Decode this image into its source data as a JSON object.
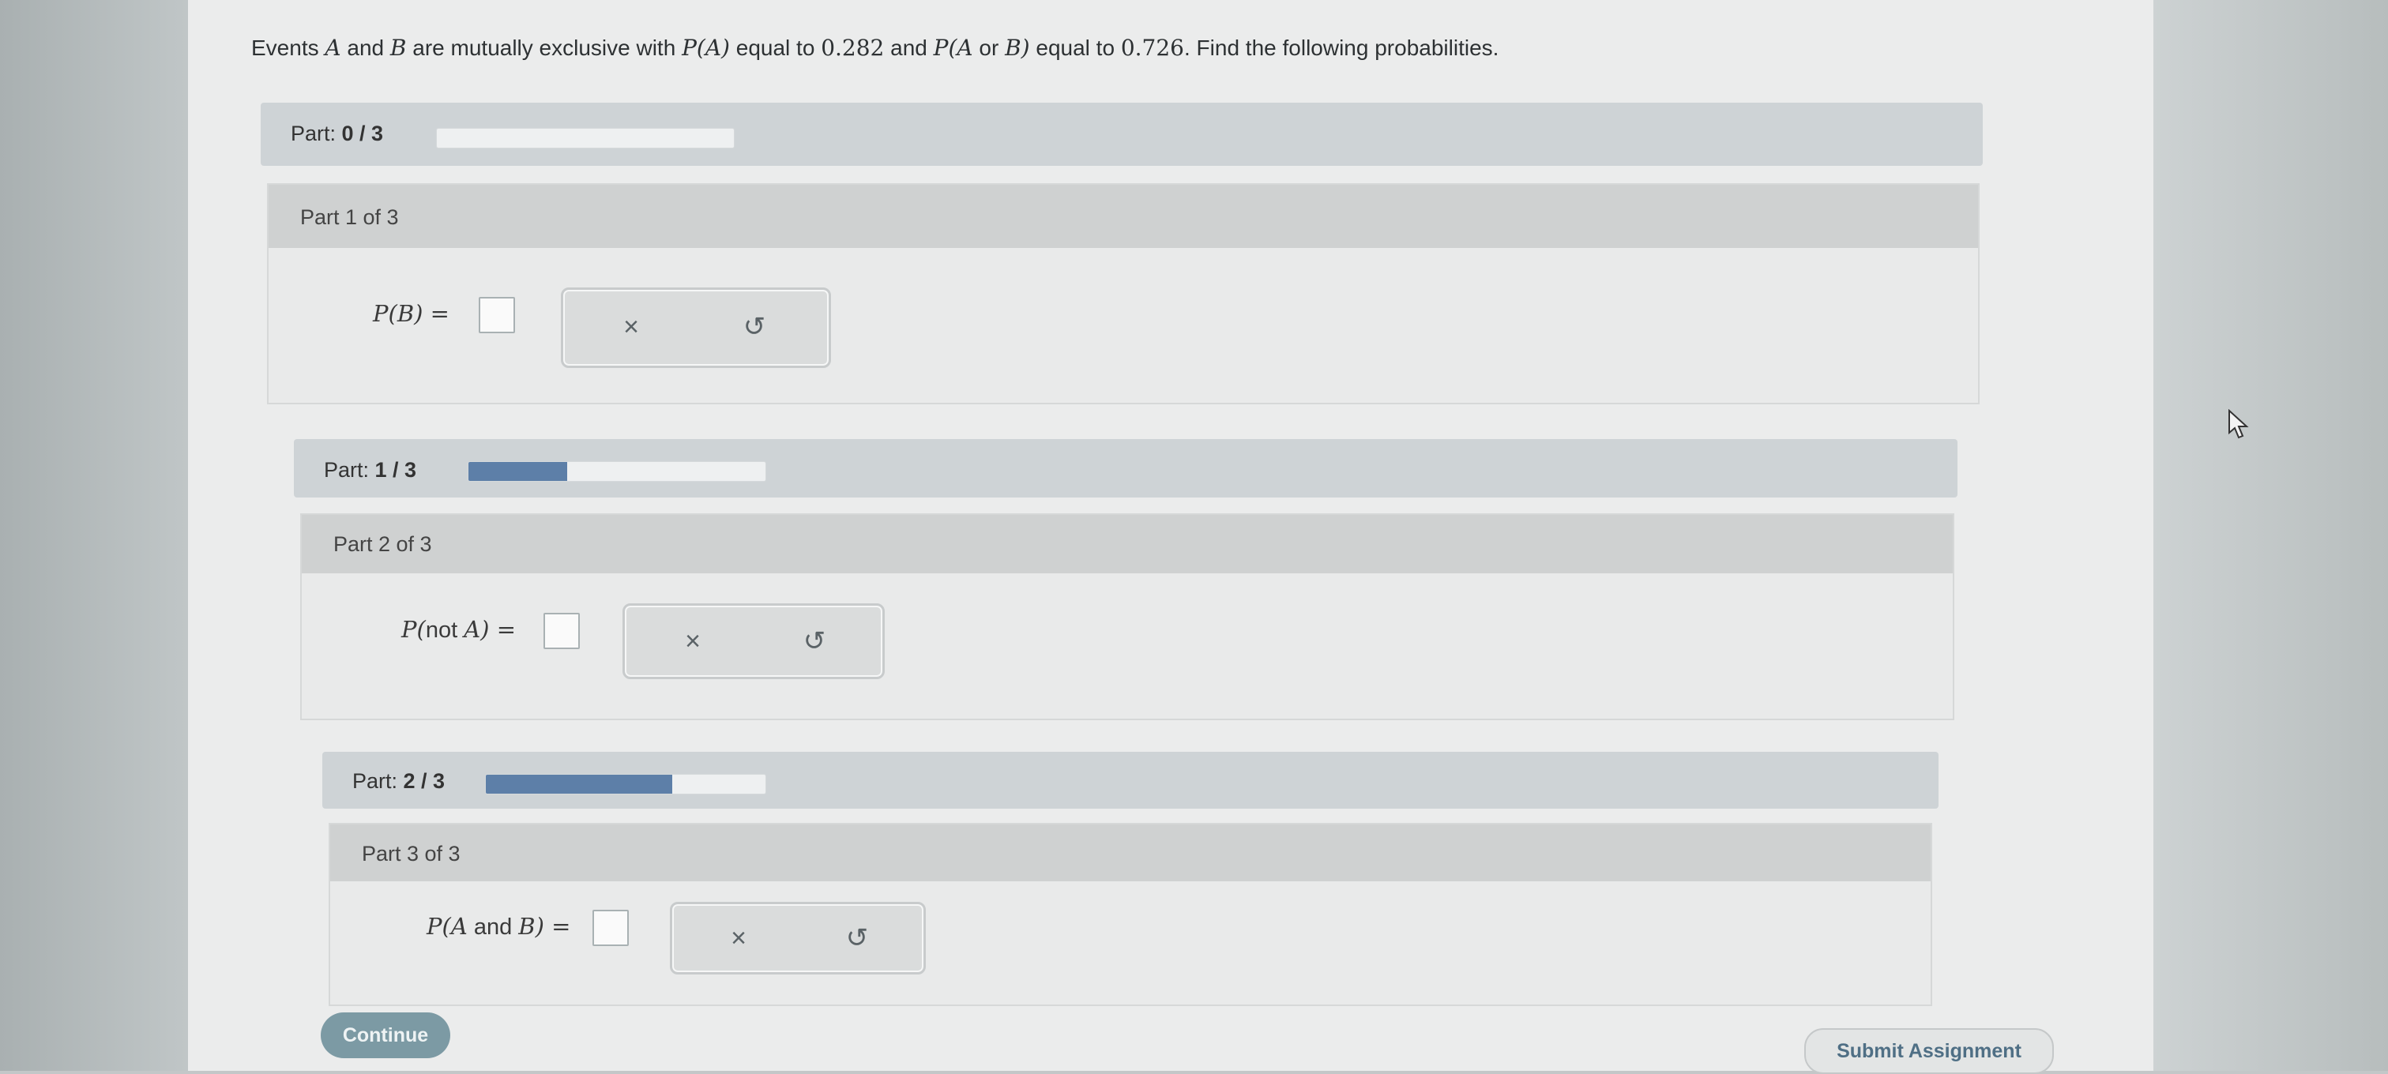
{
  "question": {
    "t1": "Events ",
    "v_a": "A",
    "t2": " and ",
    "v_b": "B",
    "t3": " are mutually exclusive with ",
    "p_a": "P",
    "p_a_arg": "(A)",
    "t4": " equal to ",
    "pa_value": "0.282",
    "t5": " and ",
    "p_aob": "P",
    "p_aob_open": "(A",
    "p_aob_or": " or ",
    "p_aob_close": "B)",
    "t6": " equal to ",
    "paob_value": "0.726",
    "t7": ". Find the following probabilities."
  },
  "progress": [
    {
      "prefix": "Part: ",
      "value": "0 / 3",
      "fraction": 0.0
    },
    {
      "prefix": "Part: ",
      "value": "1 / 3",
      "fraction": 0.333
    },
    {
      "prefix": "Part: ",
      "value": "2 / 3",
      "fraction": 0.667
    }
  ],
  "parts": [
    {
      "title": "Part 1 of 3",
      "lhs_p": "P",
      "lhs_open": "(B)",
      "lhs_mid": "",
      "lhs_close": "",
      "equals": " ="
    },
    {
      "title": "Part 2 of 3",
      "lhs_p": "P",
      "lhs_open": "(",
      "lhs_mid": "not ",
      "lhs_close": "A)",
      "equals": " ="
    },
    {
      "title": "Part 3 of 3",
      "lhs_p": "P",
      "lhs_open": "(A",
      "lhs_mid": " and ",
      "lhs_close": "B)",
      "equals": " ="
    }
  ],
  "tools": {
    "clear": "×",
    "undo": "↺"
  },
  "buttons": {
    "continue": "Continue",
    "submit": "Submit Assignment"
  }
}
